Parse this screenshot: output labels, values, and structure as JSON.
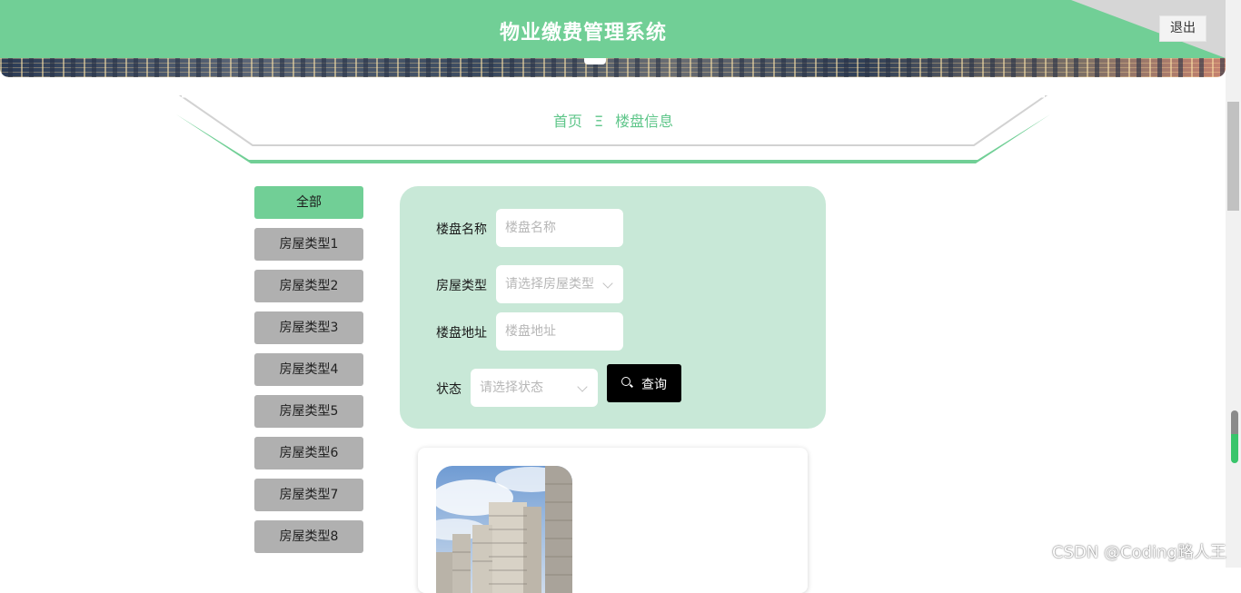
{
  "header": {
    "title": "物业缴费管理系统",
    "logout_label": "退出",
    "color": "#71cf96"
  },
  "breadcrumb": {
    "home": "首页",
    "separator": "Ξ",
    "current": "楼盘信息"
  },
  "sidebar": {
    "items": [
      {
        "label": "全部",
        "active": true
      },
      {
        "label": "房屋类型1"
      },
      {
        "label": "房屋类型2"
      },
      {
        "label": "房屋类型3"
      },
      {
        "label": "房屋类型4"
      },
      {
        "label": "房屋类型5"
      },
      {
        "label": "房屋类型6"
      },
      {
        "label": "房屋类型7"
      },
      {
        "label": "房屋类型8"
      }
    ]
  },
  "search": {
    "name_label": "楼盘名称",
    "name_placeholder": "楼盘名称",
    "type_label": "房屋类型",
    "type_placeholder": "请选择房屋类型",
    "address_label": "楼盘地址",
    "address_placeholder": "楼盘地址",
    "status_label": "状态",
    "status_placeholder": "请选择状态",
    "query_label": "查询",
    "query_icon": "search-icon"
  },
  "watermark": "CSDN @Coding路人王",
  "colors": {
    "accent": "#71cf96",
    "panel": "#c8e8d7",
    "sidebar_button": "#b0b0b0",
    "query_button": "#000000"
  }
}
